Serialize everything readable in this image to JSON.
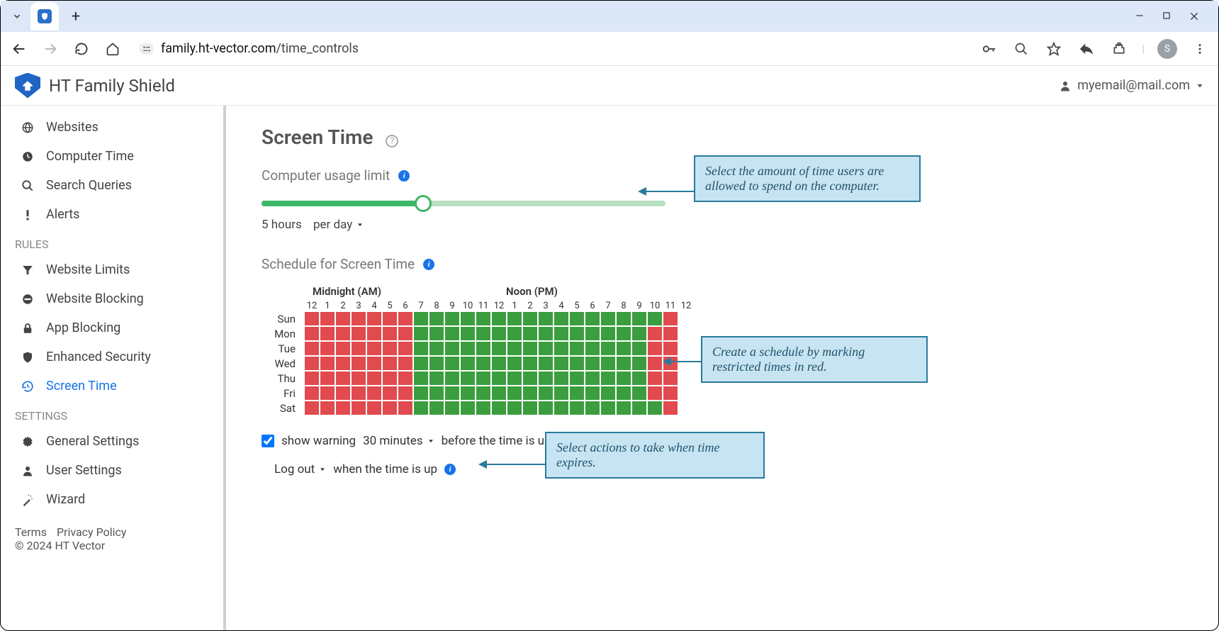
{
  "browser": {
    "url_domain": "family.ht-vector.com",
    "url_path": "/time_controls",
    "avatar_letter": "S"
  },
  "app": {
    "title": "HT Family Shield",
    "user_email": "myemail@mail.com"
  },
  "sidebar": {
    "items_top": [
      {
        "label": "Websites",
        "icon": "globe"
      },
      {
        "label": "Computer Time",
        "icon": "clock"
      },
      {
        "label": "Search Queries",
        "icon": "search"
      },
      {
        "label": "Alerts",
        "icon": "alert"
      }
    ],
    "section_rules": "RULES",
    "items_rules": [
      {
        "label": "Website Limits",
        "icon": "filter"
      },
      {
        "label": "Website Blocking",
        "icon": "minus"
      },
      {
        "label": "App Blocking",
        "icon": "lock"
      },
      {
        "label": "Enhanced Security",
        "icon": "shield"
      },
      {
        "label": "Screen Time",
        "icon": "history",
        "active": true
      }
    ],
    "section_settings": "SETTINGS",
    "items_settings": [
      {
        "label": "General Settings",
        "icon": "gear"
      },
      {
        "label": "User Settings",
        "icon": "user"
      },
      {
        "label": "Wizard",
        "icon": "wand"
      }
    ],
    "footer": {
      "terms": "Terms",
      "privacy": "Privacy Policy",
      "copyright": "© 2024 HT Vector"
    }
  },
  "page": {
    "title": "Screen Time",
    "usage_label": "Computer usage limit",
    "slider_value": "5 hours",
    "slider_per": "per day",
    "schedule_label": "Schedule for Screen Time",
    "header_am": "Midnight (AM)",
    "header_pm": "Noon (PM)",
    "hours": [
      "12",
      "1",
      "2",
      "3",
      "4",
      "5",
      "6",
      "7",
      "8",
      "9",
      "10",
      "11",
      "12",
      "1",
      "2",
      "3",
      "4",
      "5",
      "6",
      "7",
      "8",
      "9",
      "10",
      "11",
      "12"
    ],
    "days": [
      "Sun",
      "Mon",
      "Tue",
      "Wed",
      "Thu",
      "Fri",
      "Sat"
    ],
    "schedule": [
      "rrrrrrrggggggggggggggggrr",
      "rrrrrrrgggggggggggggggrrr",
      "rrrrrrrgggggggggggggggrrr",
      "rrrrrrrgggggggggggggggrrr",
      "rrrrrrrgggggggggggggggrrr",
      "rrrrrrrgggggggggggggggrrr",
      "rrrrrrrggggggggggggggggrr"
    ],
    "warn_checkbox": true,
    "warn_label": "show warning",
    "warn_time": "30 minutes",
    "warn_tail": "before the time is up",
    "action_value": "Log out",
    "action_tail": "when the time is up"
  },
  "callouts": {
    "c1": "Select the amount of time users are allowed to spend on the computer.",
    "c2": "Create a schedule by marking restricted times in red.",
    "c3": "Select actions to take when time expires."
  }
}
